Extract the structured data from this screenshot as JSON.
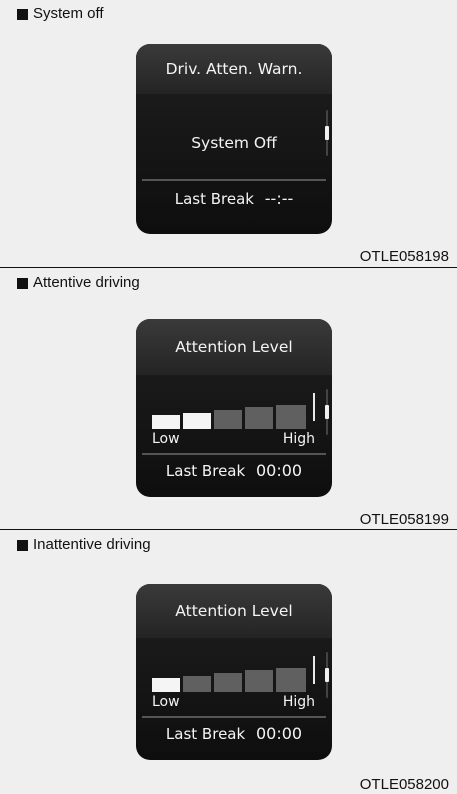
{
  "sections": [
    {
      "title": "System off",
      "figure_code": "OTLE058198",
      "display": {
        "header": "Driv. Atten. Warn.",
        "center_text": "System Off",
        "last_break_label": "Last Break",
        "last_break_value": "--:--"
      }
    },
    {
      "title": "Attentive driving",
      "figure_code": "OTLE058199",
      "display": {
        "header": "Attention Level",
        "gauge": {
          "lit_segments": 2,
          "total_segments": 5
        },
        "low_label": "Low",
        "high_label": "High",
        "last_break_label": "Last Break",
        "last_break_value": "00:00"
      }
    },
    {
      "title": "Inattentive driving",
      "figure_code": "OTLE058200",
      "display": {
        "header": "Attention Level",
        "gauge": {
          "lit_segments": 1,
          "total_segments": 5
        },
        "low_label": "Low",
        "high_label": "High",
        "last_break_label": "Last Break",
        "last_break_value": "00:00"
      }
    }
  ],
  "colors": {
    "page_bg": "#efefef",
    "panel_bg": "#141414",
    "segment_on": "#f5f5f5",
    "segment_off": "#606060"
  }
}
